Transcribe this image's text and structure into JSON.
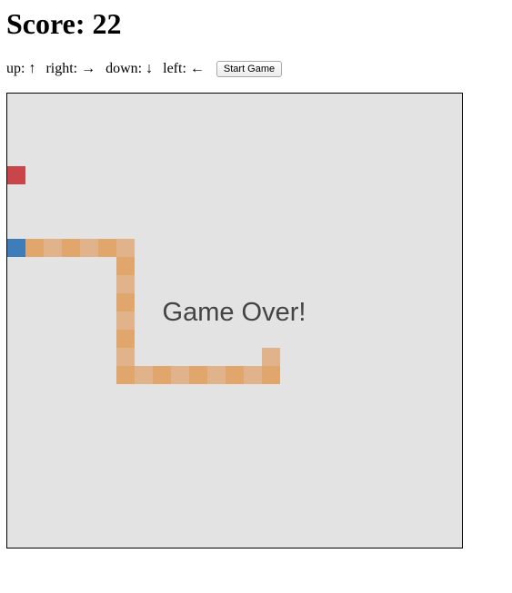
{
  "score": {
    "text": "Score: 22"
  },
  "controls": {
    "items": [
      {
        "label": "up:",
        "arrow": "↑"
      },
      {
        "label": "right:",
        "arrow": "→"
      },
      {
        "label": "down:",
        "arrow": "↓"
      },
      {
        "label": "left:",
        "arrow": "←"
      }
    ],
    "start_label": "Start Game"
  },
  "game": {
    "status_text": "Game Over!",
    "grid_size": 25,
    "food": [
      0,
      4
    ],
    "snake_head": [
      0,
      8
    ],
    "snake_body": [
      [
        1,
        8
      ],
      [
        2,
        8
      ],
      [
        3,
        8
      ],
      [
        4,
        8
      ],
      [
        5,
        8
      ],
      [
        6,
        8
      ],
      [
        6,
        9
      ],
      [
        6,
        10
      ],
      [
        6,
        11
      ],
      [
        6,
        12
      ],
      [
        6,
        13
      ],
      [
        6,
        14
      ],
      [
        6,
        15
      ],
      [
        7,
        15
      ],
      [
        8,
        15
      ],
      [
        9,
        15
      ],
      [
        10,
        15
      ],
      [
        11,
        15
      ],
      [
        12,
        15
      ],
      [
        13,
        15
      ],
      [
        14,
        15
      ],
      [
        14,
        14
      ]
    ]
  },
  "colors": {
    "board": "#e3e3e3",
    "food": "#c84649",
    "snake_head": "#3f7dba",
    "snake_body_a": "#e0a66b",
    "snake_body_b": "#e0b38b",
    "text": "#444444"
  }
}
